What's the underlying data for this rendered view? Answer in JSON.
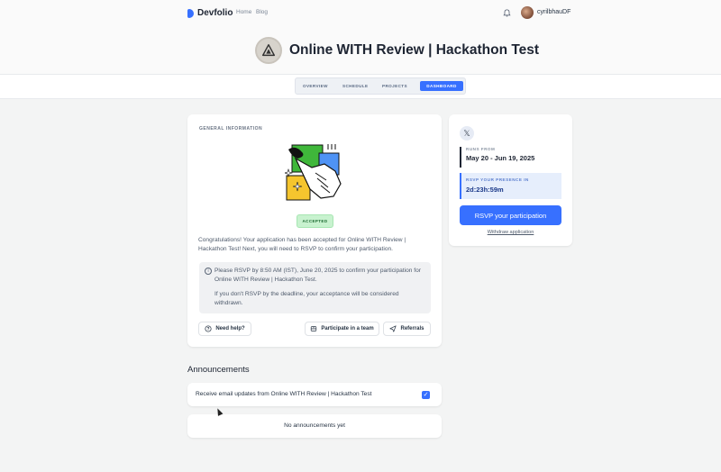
{
  "nav": {
    "brand": "Devfolio",
    "links": [
      "Home",
      "Blog"
    ],
    "username": "cyrilbhauDF",
    "accent_color": "#3770ff"
  },
  "hackathon": {
    "title": "Online WITH Review | Hackathon Test"
  },
  "tabs": {
    "overview": "OVERVIEW",
    "schedule": "SCHEDULE",
    "projects": "PROJECTS",
    "dashboard": "DASHBOARD",
    "active": "DASHBOARD"
  },
  "general": {
    "label": "GENERAL INFORMATION",
    "status_badge": "ACCEPTED",
    "status_color": "#c8f2cf",
    "congrats_text": "Congratulations! Your application has been accepted for Online WITH Review | Hackathon Test! Next, you will need to RSVP to confirm your participation.",
    "info_icon": "info-icon",
    "info_text_1": "Please RSVP by 8:50 AM (IST), June 20, 2025 to confirm your participation for Online WITH Review | Hackathon Test.",
    "info_text_2": "If you don't RSVP by the deadline, your acceptance will be considered withdrawn.",
    "buttons": {
      "help": "Need help?",
      "team": "Participate in a team",
      "referrals": "Referrals"
    }
  },
  "sidebar": {
    "social_icon": "x-twitter-icon",
    "runs_label": "RUNS FROM",
    "runs_value": "May 20 - Jun 19, 2025",
    "rsvp_label": "RSVP YOUR PRESENCE IN",
    "rsvp_countdown": "2d:23h:59m",
    "rsvp_button": "RSVP your participation",
    "withdraw_link": "Withdraw application"
  },
  "announcements": {
    "title": "Announcements",
    "email_updates_label": "Receive email updates from Online WITH Review | Hackathon Test",
    "email_updates_checked": true,
    "empty_text": "No announcements yet"
  }
}
